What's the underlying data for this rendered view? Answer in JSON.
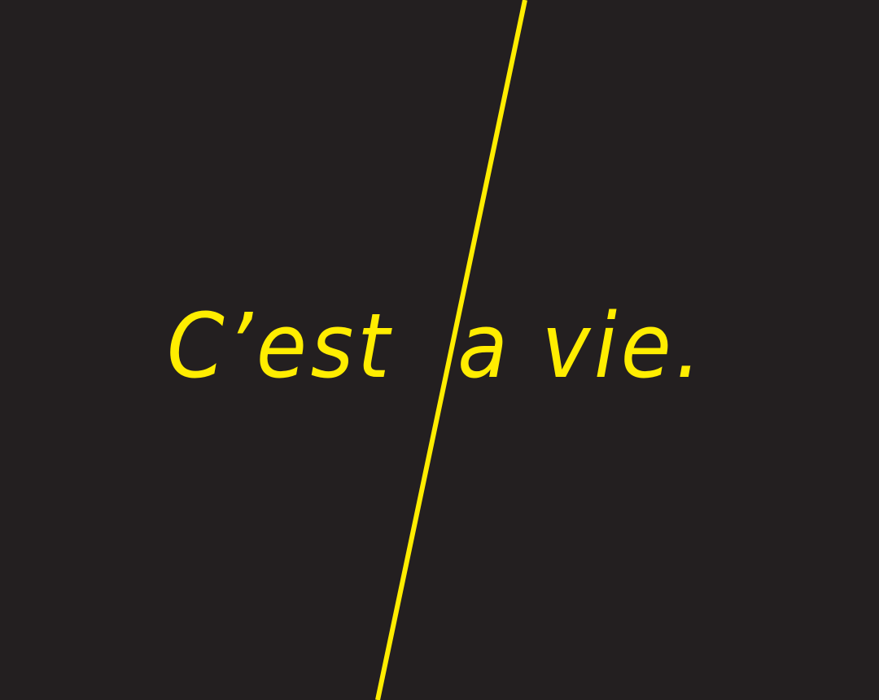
{
  "colors": {
    "background": "#231f20",
    "accent": "#ffed00"
  },
  "phrase": {
    "left": "C’est",
    "right": "a vie."
  }
}
